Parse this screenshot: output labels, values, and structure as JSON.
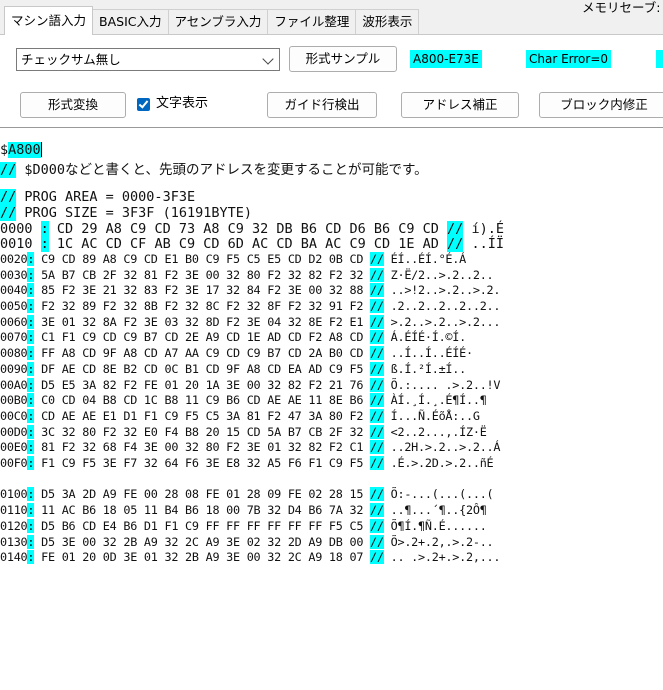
{
  "tabs": [
    {
      "label": "マシン語入力",
      "active": true
    },
    {
      "label": "BASIC入力",
      "active": false
    },
    {
      "label": "アセンブラ入力",
      "active": false
    },
    {
      "label": "ファイル整理",
      "active": false
    },
    {
      "label": "波形表示",
      "active": false
    }
  ],
  "memory_label": "メモリセーブ:",
  "checksum_select": {
    "value": "チェックサム無し"
  },
  "buttons": {
    "format_sample": "形式サンプル",
    "format_convert": "形式変換",
    "guide_detect": "ガイド行検出",
    "address_fix": "アドレス補正",
    "block_fix": "ブロック内修正"
  },
  "status": {
    "checksum_range": "A800-E73E",
    "char_error": "Char Error=0"
  },
  "show_chars": {
    "label": "文字表示",
    "checked": true
  },
  "colors": {
    "highlight": "#00ffff",
    "checkbox": "#0067c0"
  },
  "editor_lines": [
    {
      "parts": [
        {
          "t": "$"
        },
        {
          "t": "A800",
          "hl": true
        }
      ],
      "caret": true
    },
    {
      "parts": [
        {
          "t": "//",
          "hl": true
        },
        {
          "t": " $D000などと書くと、先頭のアドレスを変更することが可能です。"
        }
      ]
    },
    {
      "parts": []
    },
    {
      "parts": [
        {
          "t": "//",
          "hl": true
        },
        {
          "t": " PROG AREA = 0000-3F3E"
        }
      ]
    },
    {
      "parts": [
        {
          "t": "//",
          "hl": true
        },
        {
          "t": " PROG SIZE = 3F3F (16191BYTE)"
        }
      ]
    },
    {
      "parts": [
        {
          "t": "0000 "
        },
        {
          "t": ":",
          "hl": true
        },
        {
          "t": " CD 29 A8 C9 CD 73 A8 C9 32 DB B6 CD D6 B6 C9 CD "
        },
        {
          "t": "//",
          "hl": true
        },
        {
          "t": " í).É"
        }
      ]
    },
    {
      "parts": [
        {
          "t": "0010 "
        },
        {
          "t": ":",
          "hl": true
        },
        {
          "t": " 1C AC CD CF AB C9 CD 6D AC CD BA AC C9 CD 1E AD "
        },
        {
          "t": "//",
          "hl": true
        },
        {
          "t": " ..ÍÏ"
        }
      ]
    },
    {
      "small": true,
      "parts": [
        {
          "t": "0020"
        },
        {
          "t": ":",
          "hl": true
        },
        {
          "t": " C9 CD 89 A8 C9 CD E1 B0 C9 F5 C5 E5 CD D2 0B CD "
        },
        {
          "t": "//",
          "hl": true
        },
        {
          "t": " ÉÍ..ÉÍ.°É.Á"
        }
      ]
    },
    {
      "small": true,
      "parts": [
        {
          "t": "0030"
        },
        {
          "t": ":",
          "hl": true
        },
        {
          "t": " 5A B7 CB 2F 32 81 F2 3E 00 32 80 F2 32 82 F2 32 "
        },
        {
          "t": "//",
          "hl": true
        },
        {
          "t": " Z·Ë/2..>.2..2.."
        }
      ]
    },
    {
      "small": true,
      "parts": [
        {
          "t": "0040"
        },
        {
          "t": ":",
          "hl": true
        },
        {
          "t": " 85 F2 3E 21 32 83 F2 3E 17 32 84 F2 3E 00 32 88 "
        },
        {
          "t": "//",
          "hl": true
        },
        {
          "t": " ..>!2..>.2..>.2."
        }
      ]
    },
    {
      "small": true,
      "parts": [
        {
          "t": "0050"
        },
        {
          "t": ":",
          "hl": true
        },
        {
          "t": " F2 32 89 F2 32 8B F2 32 8C F2 32 8F F2 32 91 F2 "
        },
        {
          "t": "//",
          "hl": true
        },
        {
          "t": " .2..2..2..2..2.."
        }
      ]
    },
    {
      "small": true,
      "parts": [
        {
          "t": "0060"
        },
        {
          "t": ":",
          "hl": true
        },
        {
          "t": " 3E 01 32 8A F2 3E 03 32 8D F2 3E 04 32 8E F2 E1 "
        },
        {
          "t": "//",
          "hl": true
        },
        {
          "t": " >.2..>.2..>.2..."
        }
      ]
    },
    {
      "small": true,
      "parts": [
        {
          "t": "0070"
        },
        {
          "t": ":",
          "hl": true
        },
        {
          "t": " C1 F1 C9 CD C9 B7 CD 2E A9 CD 1E AD CD F2 A8 CD "
        },
        {
          "t": "//",
          "hl": true
        },
        {
          "t": " Á.ÉÍÉ·Í.©Í."
        }
      ]
    },
    {
      "small": true,
      "parts": [
        {
          "t": "0080"
        },
        {
          "t": ":",
          "hl": true
        },
        {
          "t": " FF A8 CD 9F A8 CD A7 AA C9 CD C9 B7 CD 2A B0 CD "
        },
        {
          "t": "//",
          "hl": true
        },
        {
          "t": " ..Í..Í..ÉÍÉ·"
        }
      ]
    },
    {
      "small": true,
      "parts": [
        {
          "t": "0090"
        },
        {
          "t": ":",
          "hl": true
        },
        {
          "t": " DF AE CD 8E B2 CD 0C B1 CD 9F A8 CD EA AD C9 F5 "
        },
        {
          "t": "//",
          "hl": true
        },
        {
          "t": " ß.Í.²Í.±Í.."
        }
      ]
    },
    {
      "small": true,
      "parts": [
        {
          "t": "00A0"
        },
        {
          "t": ":",
          "hl": true
        },
        {
          "t": " D5 E5 3A 82 F2 FE 01 20 1A 3E 00 32 82 F2 21 76 "
        },
        {
          "t": "//",
          "hl": true
        },
        {
          "t": " Õ.:.... .>.2..!V"
        }
      ]
    },
    {
      "small": true,
      "parts": [
        {
          "t": "00B0"
        },
        {
          "t": ":",
          "hl": true
        },
        {
          "t": " C0 CD 04 B8 CD 1C B8 11 C9 B6 CD AE AE 11 8E B6 "
        },
        {
          "t": "//",
          "hl": true
        },
        {
          "t": " ÀÍ.¸Í.¸.É¶Í..¶"
        }
      ]
    },
    {
      "small": true,
      "parts": [
        {
          "t": "00C0"
        },
        {
          "t": ":",
          "hl": true
        },
        {
          "t": " CD AE AE E1 D1 F1 C9 F5 C5 3A 81 F2 47 3A 80 F2 "
        },
        {
          "t": "//",
          "hl": true
        },
        {
          "t": " Í...Ñ.ÉõÅ:..G"
        }
      ]
    },
    {
      "small": true,
      "parts": [
        {
          "t": "00D0"
        },
        {
          "t": ":",
          "hl": true
        },
        {
          "t": " 3C 32 80 F2 32 E0 F4 B8 20 15 CD 5A B7 CB 2F 32 "
        },
        {
          "t": "//",
          "hl": true
        },
        {
          "t": " <2..2...,.ÍZ·Ë"
        }
      ]
    },
    {
      "small": true,
      "parts": [
        {
          "t": "00E0"
        },
        {
          "t": ":",
          "hl": true
        },
        {
          "t": " 81 F2 32 68 F4 3E 00 32 80 F2 3E 01 32 82 F2 C1 "
        },
        {
          "t": "//",
          "hl": true
        },
        {
          "t": " ..2H.>.2..>.2..Á"
        }
      ]
    },
    {
      "small": true,
      "parts": [
        {
          "t": "00F0"
        },
        {
          "t": ":",
          "hl": true
        },
        {
          "t": " F1 C9 F5 3E F7 32 64 F6 3E E8 32 A5 F6 F1 C9 F5 "
        },
        {
          "t": "//",
          "hl": true
        },
        {
          "t": " .É.>.2D.>.2..ñÉ"
        }
      ]
    },
    {
      "parts": []
    },
    {
      "small": true,
      "parts": [
        {
          "t": "0100"
        },
        {
          "t": ":",
          "hl": true
        },
        {
          "t": " D5 3A 2D A9 FE 00 28 08 FE 01 28 09 FE 02 28 15 "
        },
        {
          "t": "//",
          "hl": true
        },
        {
          "t": " Õ:-...(...(...("
        }
      ]
    },
    {
      "small": true,
      "parts": [
        {
          "t": "0110"
        },
        {
          "t": ":",
          "hl": true
        },
        {
          "t": " 11 AC B6 18 05 11 B4 B6 18 00 7B 32 D4 B6 7A 32 "
        },
        {
          "t": "//",
          "hl": true
        },
        {
          "t": " ..¶...´¶..{2Ô¶"
        }
      ]
    },
    {
      "small": true,
      "parts": [
        {
          "t": "0120"
        },
        {
          "t": ":",
          "hl": true
        },
        {
          "t": " D5 B6 CD E4 B6 D1 F1 C9 FF FF FF FF FF FF F5 C5 "
        },
        {
          "t": "//",
          "hl": true
        },
        {
          "t": " Õ¶Í.¶Ñ.É......"
        }
      ]
    },
    {
      "small": true,
      "parts": [
        {
          "t": "0130"
        },
        {
          "t": ":",
          "hl": true
        },
        {
          "t": " D5 3E 00 32 2B A9 32 2C A9 3E 02 32 2D A9 DB 00 "
        },
        {
          "t": "//",
          "hl": true
        },
        {
          "t": " Õ>.2+.2,.>.2-.."
        }
      ]
    },
    {
      "small": true,
      "parts": [
        {
          "t": "0140"
        },
        {
          "t": ":",
          "hl": true
        },
        {
          "t": " FE 01 20 0D 3E 01 32 2B A9 3E 00 32 2C A9 18 07 "
        },
        {
          "t": "//",
          "hl": true
        },
        {
          "t": " .. .>.2+.>.2,..."
        }
      ]
    }
  ]
}
